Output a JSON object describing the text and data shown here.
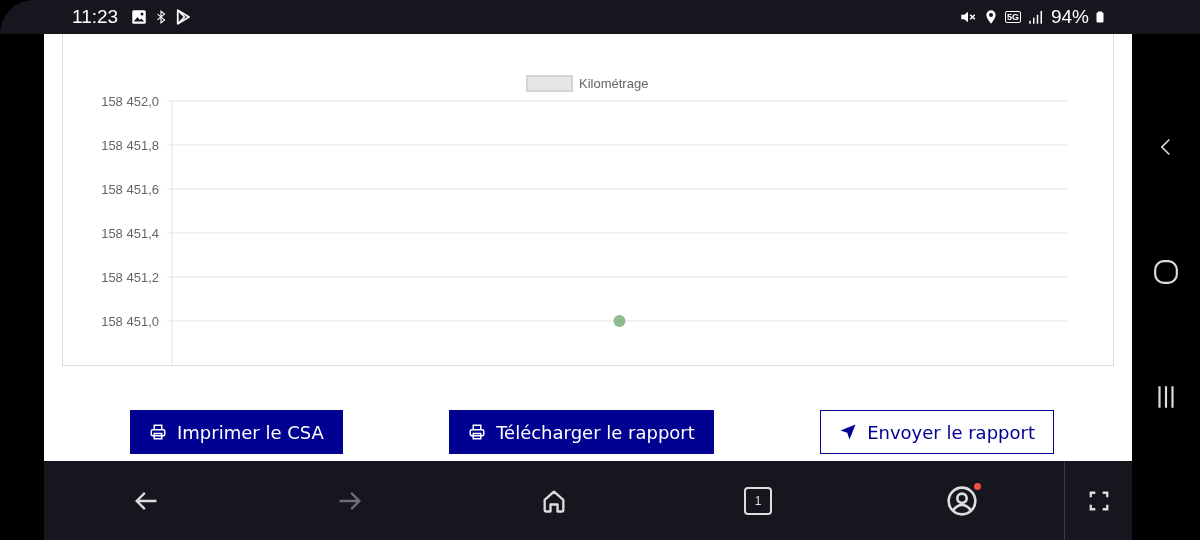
{
  "status_bar": {
    "time": "11:23",
    "network": "5G",
    "battery": "94%"
  },
  "chart": {
    "chart_data": {
      "type": "scatter",
      "grid": true,
      "series": [
        {
          "name": "Kilométrage",
          "color": "#8fbc8f",
          "values": [
            158451.0
          ]
        }
      ],
      "ylim": [
        158450.8,
        158452.0
      ],
      "yticks": [
        {
          "value": 158452.0,
          "label": "158 452,0"
        },
        {
          "value": 158451.8,
          "label": "158 451,8"
        },
        {
          "value": 158451.6,
          "label": "158 451,6"
        },
        {
          "value": 158451.4,
          "label": "158 451,4"
        },
        {
          "value": 158451.2,
          "label": "158 451,2"
        },
        {
          "value": 158451.0,
          "label": "158 451,0"
        }
      ]
    }
  },
  "buttons": [
    {
      "label": "Imprimer le CSA",
      "kind": "primary"
    },
    {
      "label": "Télécharger le rapport",
      "kind": "primary"
    },
    {
      "label": "Envoyer le rapport",
      "kind": "secondary"
    }
  ],
  "browser_bar": {
    "forward_disabled": true,
    "tab_count": "1",
    "account_notification": true
  }
}
